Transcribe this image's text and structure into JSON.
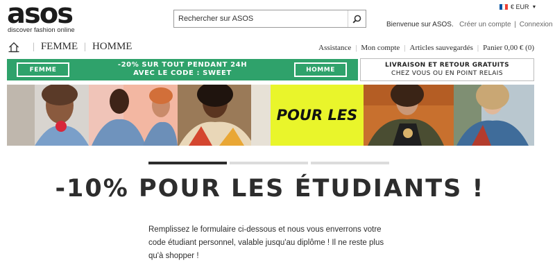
{
  "header": {
    "logo_text": "asos",
    "tagline": "discover fashion online",
    "search_placeholder": "Rechercher sur ASOS",
    "currency": "€ EUR",
    "currency_caret": "▼",
    "welcome": "Bienvenue sur ASOS.",
    "create_account": "Créer un compte",
    "separator": "|",
    "login": "Connexion"
  },
  "nav": {
    "women": "FEMME",
    "men": "HOMME",
    "links": [
      "Assistance",
      "Mon compte",
      "Articles sauvegardés",
      "Panier 0,00 € (0)"
    ]
  },
  "promo": {
    "left_button": "FEMME",
    "line1": "-20% SUR TOUT PENDANT 24H",
    "line2": "AVEC LE CODE : SWEET",
    "right_button": "HOMME",
    "shipping_line1": "LIVRAISON ET RETOUR GRATUITS",
    "shipping_line2": "CHEZ VOUS OU EN POINT RELAIS"
  },
  "hero": {
    "center_text": "POUR LES",
    "slide_indicator": {
      "total": 3,
      "active": 1
    }
  },
  "content": {
    "headline": "-10% POUR LES ÉTUDIANTS !",
    "description": "Remplissez le formulaire ci-dessous et nous vous enverrons votre code étudiant personnel, valable jusqu'au diplôme ! Il ne reste plus qu'à shopper !"
  },
  "colors": {
    "promo_green": "#2fa26b",
    "hero_yellow": "#e9f52b",
    "text_dark": "#2d2d2d",
    "flag": [
      "#0055a4",
      "#ffffff",
      "#ef4135"
    ]
  },
  "icons": {
    "search": "search-icon",
    "home": "home-icon",
    "flag": "flag-fr-icon"
  }
}
